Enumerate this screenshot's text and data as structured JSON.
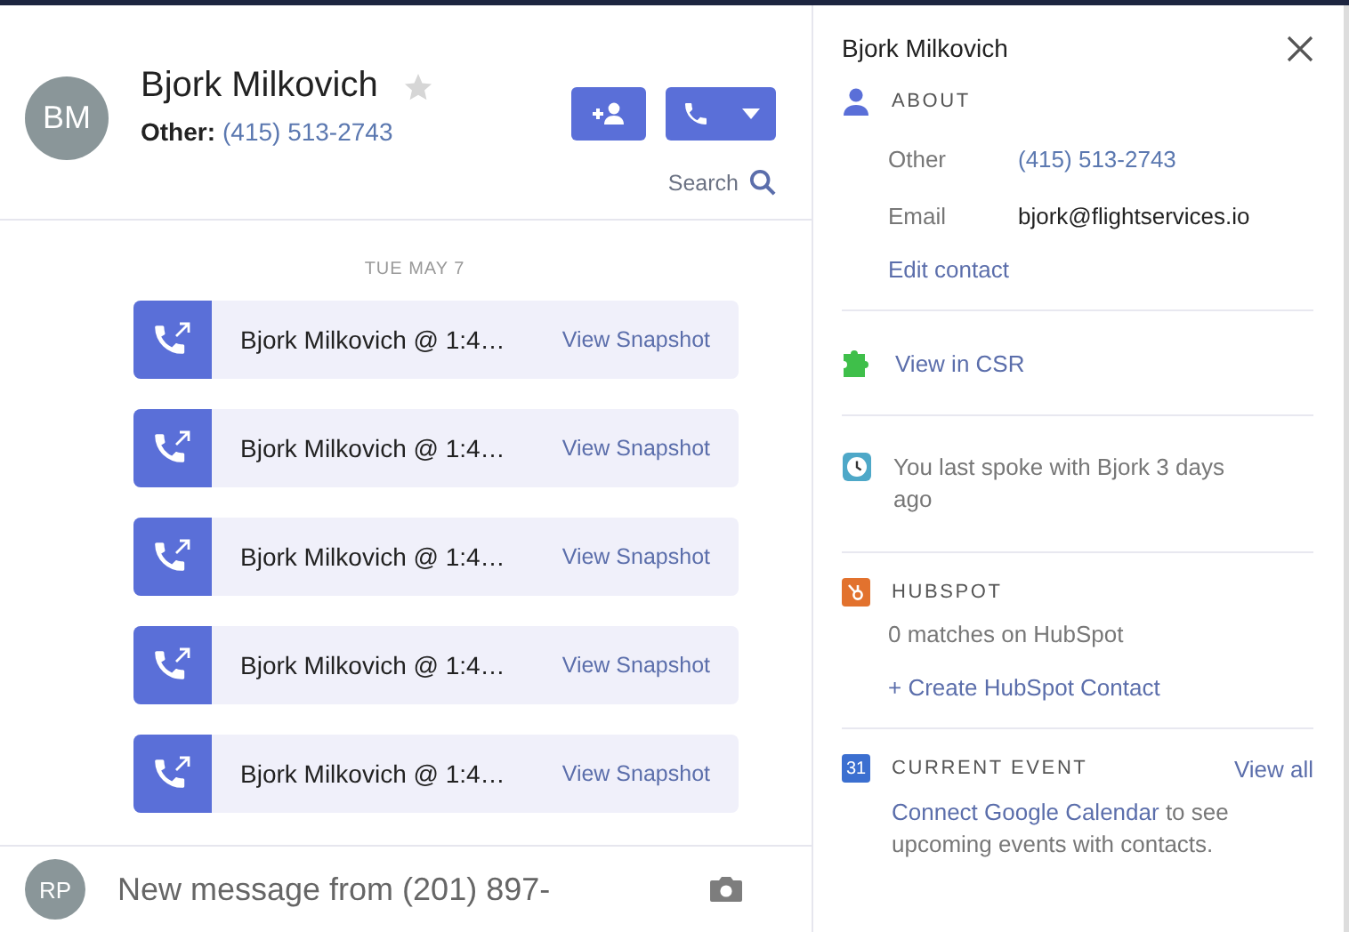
{
  "contact": {
    "initials": "BM",
    "name": "Bjork Milkovich",
    "starred": false,
    "phone_label": "Other:",
    "phone": "(415) 513-2743"
  },
  "search": {
    "label": "Search"
  },
  "date_label": "TUE MAY 7",
  "calls": [
    {
      "title": "Bjork Milkovich @ 1:4…",
      "action": "View Snapshot"
    },
    {
      "title": "Bjork Milkovich @ 1:4…",
      "action": "View Snapshot"
    },
    {
      "title": "Bjork Milkovich @ 1:4…",
      "action": "View Snapshot"
    },
    {
      "title": "Bjork Milkovich @ 1:4…",
      "action": "View Snapshot"
    },
    {
      "title": "Bjork Milkovich @ 1:4…",
      "action": "View Snapshot"
    }
  ],
  "composer": {
    "initials": "RP",
    "placeholder": "New message from (201) 897-"
  },
  "panel": {
    "title": "Bjork Milkovich",
    "about": {
      "heading": "ABOUT",
      "fields": [
        {
          "label": "Other",
          "value": "(415) 513-2743",
          "kind": "link"
        },
        {
          "label": "Email",
          "value": "bjork@flightservices.io",
          "kind": "text"
        }
      ],
      "edit": "Edit contact"
    },
    "csr": "View in CSR",
    "last_spoke": "You last spoke with Bjork 3 days ago",
    "hubspot": {
      "heading": "HUBSPOT",
      "matches": "0 matches on HubSpot",
      "create": "+ Create HubSpot Contact"
    },
    "event": {
      "icon_label": "31",
      "heading": "CURRENT EVENT",
      "view_all": "View all",
      "link": "Connect Google Calendar",
      "text": " to see upcoming events with contacts."
    }
  }
}
